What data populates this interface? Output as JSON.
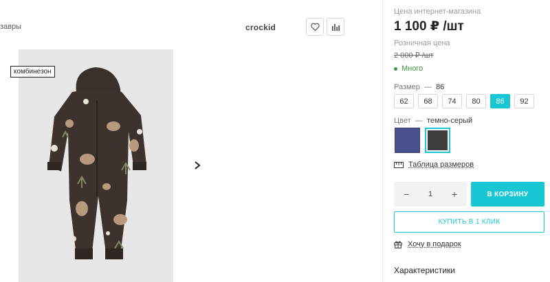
{
  "breadcrumb": {
    "tail": "завры"
  },
  "brand": {
    "name": "crockid"
  },
  "product": {
    "tag": "комбинезон"
  },
  "price": {
    "online_label": "Цена интернет-магазина",
    "online_value": "1 100 ₽ /шт",
    "retail_label": "Розничная цена",
    "retail_value": "2 000 ₽ /шт",
    "stock_text": "Много"
  },
  "size": {
    "label": "Размер",
    "dash": "—",
    "selected": "86",
    "options": [
      "62",
      "68",
      "74",
      "80",
      "86",
      "92"
    ]
  },
  "color": {
    "label": "Цвет",
    "dash": "—",
    "selected": "темно-серый",
    "swatches": [
      "#4a4f8e",
      "#3d3d3d"
    ]
  },
  "size_table_link": "Таблица размеров",
  "quantity": {
    "minus": "−",
    "value": "1",
    "plus": "+"
  },
  "buttons": {
    "cart": "В КОРЗИНУ",
    "one_click": "КУПИТЬ В 1 КЛИК"
  },
  "gift_link": "Хочу в подарок",
  "characteristics": "Характеристики",
  "accent_color": "#19c6d4"
}
